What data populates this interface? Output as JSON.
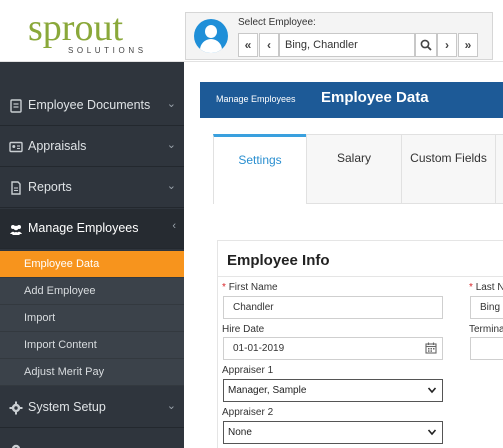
{
  "header": {
    "logo_word": "sprout",
    "logo_sub": "SOLUTIONS",
    "employee_label": "Select Employee:",
    "employee_value": "Bing, Chandler",
    "nav": {
      "first": "«",
      "prev": "‹",
      "next": "›",
      "last": "»"
    }
  },
  "sidebar": {
    "items": [
      {
        "label": "Employee Documents"
      },
      {
        "label": "Appraisals"
      },
      {
        "label": "Reports"
      },
      {
        "label": "Manage Employees"
      },
      {
        "label": "System Setup"
      }
    ],
    "subitems": [
      {
        "label": "Employee Data"
      },
      {
        "label": "Add Employee"
      },
      {
        "label": "Import"
      },
      {
        "label": "Import Content"
      },
      {
        "label": "Adjust Merit Pay"
      }
    ]
  },
  "main": {
    "breadcrumb": "Manage Employees",
    "title": "Employee Data",
    "tabs": [
      {
        "label": "Settings"
      },
      {
        "label": "Salary"
      },
      {
        "label": "Custom Fields"
      }
    ],
    "section_title": "Employee Info",
    "fields": {
      "first_name_label": "First Name",
      "first_name_value": "Chandler",
      "last_name_label": "Last N",
      "last_name_value": "Bing",
      "hire_date_label": "Hire Date",
      "hire_date_value": "01-01-2019",
      "termination_label": "Termina",
      "appraiser1_label": "Appraiser 1",
      "appraiser1_value": "Manager, Sample",
      "appraiser2_label": "Appraiser 2",
      "appraiser2_value": "None"
    }
  },
  "colors": {
    "sidebar_bg": "#2f353d",
    "selected": "#f7941d",
    "banner": "#1d5a97",
    "tab_accent": "#3aa0de",
    "brand_green": "#8aa83a"
  }
}
